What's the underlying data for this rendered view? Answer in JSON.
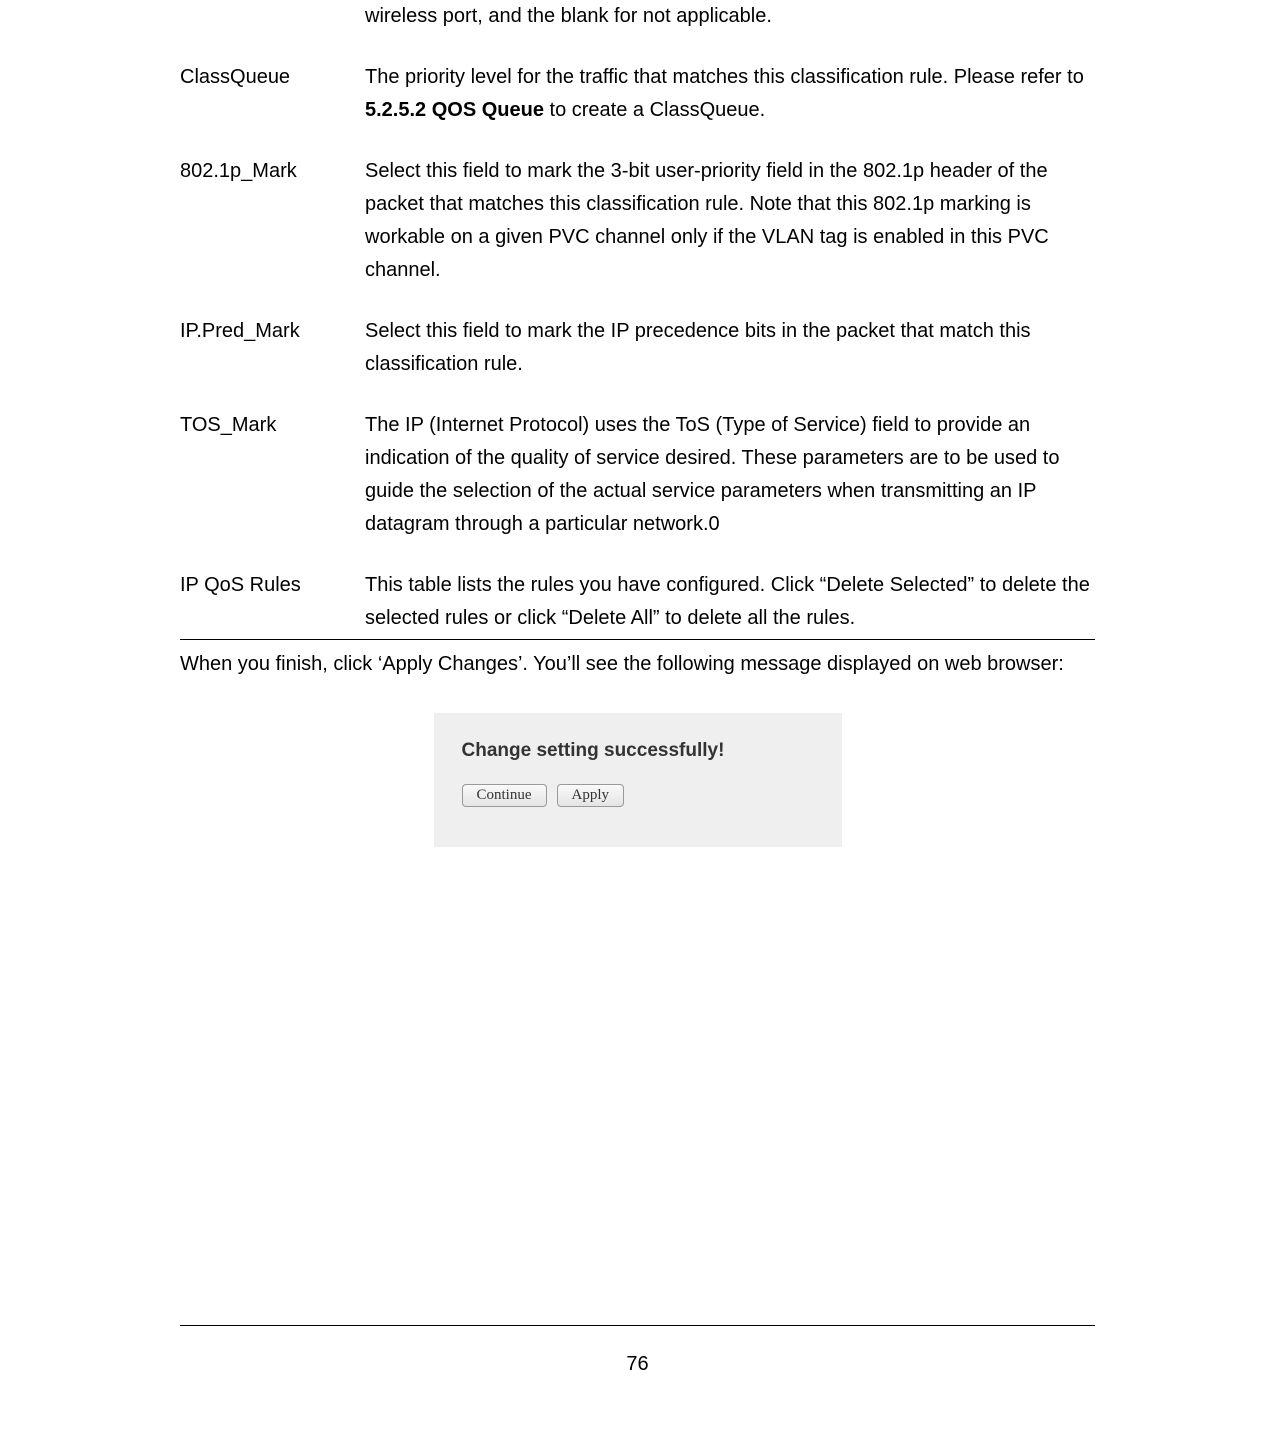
{
  "definitions": {
    "partial_first_desc": "wireless port, and the blank for not applicable.",
    "classqueue": {
      "term": "ClassQueue",
      "desc_before_bold": "The priority level for the traffic that matches this classification rule. Please refer to ",
      "bold_ref": "5.2.5.2 QOS Queue",
      "desc_after_bold": " to create a ClassQueue."
    },
    "mark_8021p": {
      "term": "802.1p_Mark",
      "desc": "Select this field to mark the 3-bit user-priority field in the 802.1p header of the packet that matches this classification rule. Note that this 802.1p marking is workable on a given PVC channel only if the VLAN tag is enabled in this PVC channel."
    },
    "ip_pred": {
      "term": "IP.Pred_Mark",
      "desc": "Select this field to mark the IP precedence bits in the packet that match this classification rule."
    },
    "tos_mark": {
      "term": "TOS_Mark",
      "desc": "The IP (Internet Protocol) uses the ToS (Type of Service) field to provide an indication of the quality of service desired. These parameters are to be used to guide the selection of the actual service parameters when transmitting an IP datagram through a particular network.0"
    },
    "ip_qos": {
      "term": "IP QoS Rules",
      "desc": "This table lists the rules you have configured. Click “Delete Selected” to delete the selected rules or click “Delete All” to delete all the rules."
    }
  },
  "after_text": "When you finish, click ‘Apply Changes’. You’ll see the following message displayed on web browser:",
  "dialog": {
    "title": "Change setting successfully!",
    "continue_btn": "Continue",
    "apply_btn": "Apply"
  },
  "page_number": "76"
}
